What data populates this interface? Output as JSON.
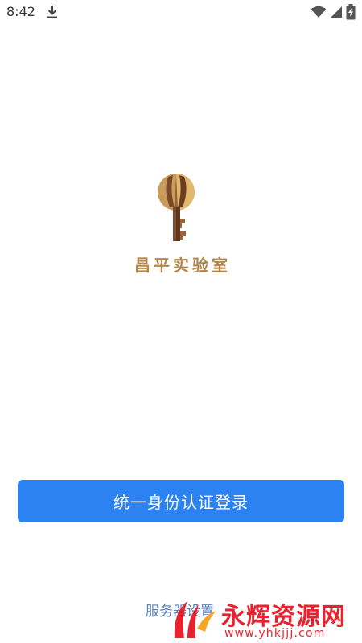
{
  "status_bar": {
    "time": "8:42",
    "icons": [
      "download-icon",
      "wifi-icon",
      "signal-icon",
      "battery-charging-icon"
    ]
  },
  "logo": {
    "icon": "key-logo-icon",
    "text": "昌平实验室"
  },
  "login": {
    "button_label": "统一身份认证登录"
  },
  "footer": {
    "service_settings_label": "服务器设置"
  },
  "watermark": {
    "title": "永辉资源网",
    "url": "www.yhkjjj.com"
  },
  "colors": {
    "primary": "#2c82f0",
    "logo_gold": "#b3874c",
    "link": "#5a7fb6",
    "watermark_red": "#e8232e"
  }
}
